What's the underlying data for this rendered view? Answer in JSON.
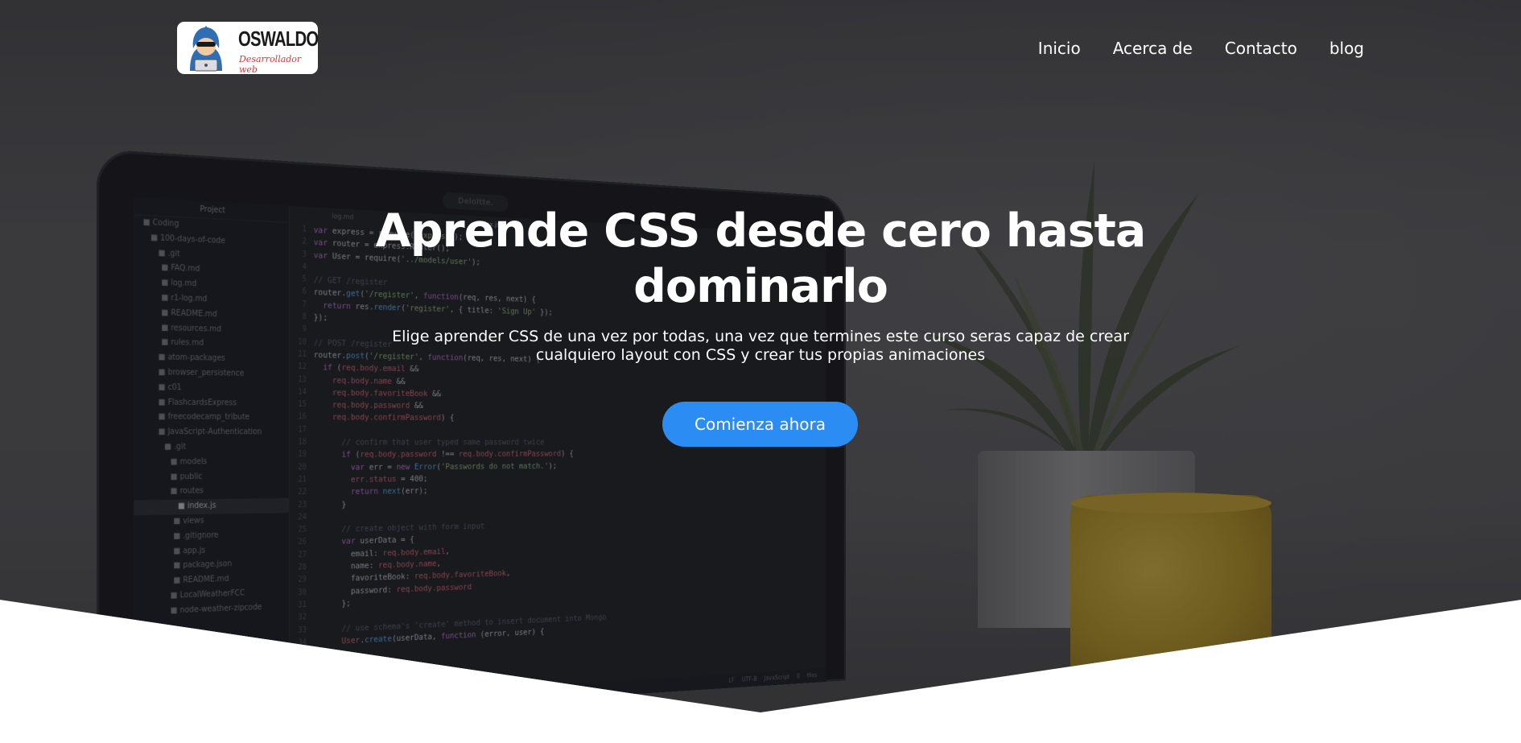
{
  "brand": {
    "name": "OSWALDO",
    "subtitle": "Desarrollador web"
  },
  "nav": {
    "items": [
      "Inicio",
      "Acerca de",
      "Contacto",
      "blog"
    ]
  },
  "hero": {
    "title": "Aprende CSS desde cero hasta dominarlo",
    "subtitle": "Elige aprender CSS de una vez por todas, una vez que termines este curso seras capaz de crear cualquiero layout con CSS y crear tus propias animaciones",
    "cta_label": "Comienza ahora"
  },
  "colors": {
    "cta": "#2b8cf3",
    "text": "#ffffff",
    "background": "#ffffff"
  },
  "editor": {
    "camera_label": "Deloitte.",
    "project_title": "Project",
    "tabs": [
      "log.md",
      "index.js"
    ],
    "tree": [
      "Coding",
      "100-days-of-code",
      ".git",
      "FAQ.md",
      "log.md",
      "r1-log.md",
      "README.md",
      "resources.md",
      "rules.md",
      "atom-packages",
      "browser_persistence",
      "c01",
      "FlashcardsExpress",
      "freecodecamp_tribute",
      "JavaScript-Authentication",
      ".git",
      "models",
      "public",
      "routes",
      "index.js",
      "views",
      ".gitignore",
      "app.js",
      "package.json",
      "README.md",
      "LocalWeatherFCC",
      "node-weather-zipcode"
    ],
    "tree_selected": 19,
    "statusbar": "LF UTF-8 JavaScript 0 files"
  }
}
